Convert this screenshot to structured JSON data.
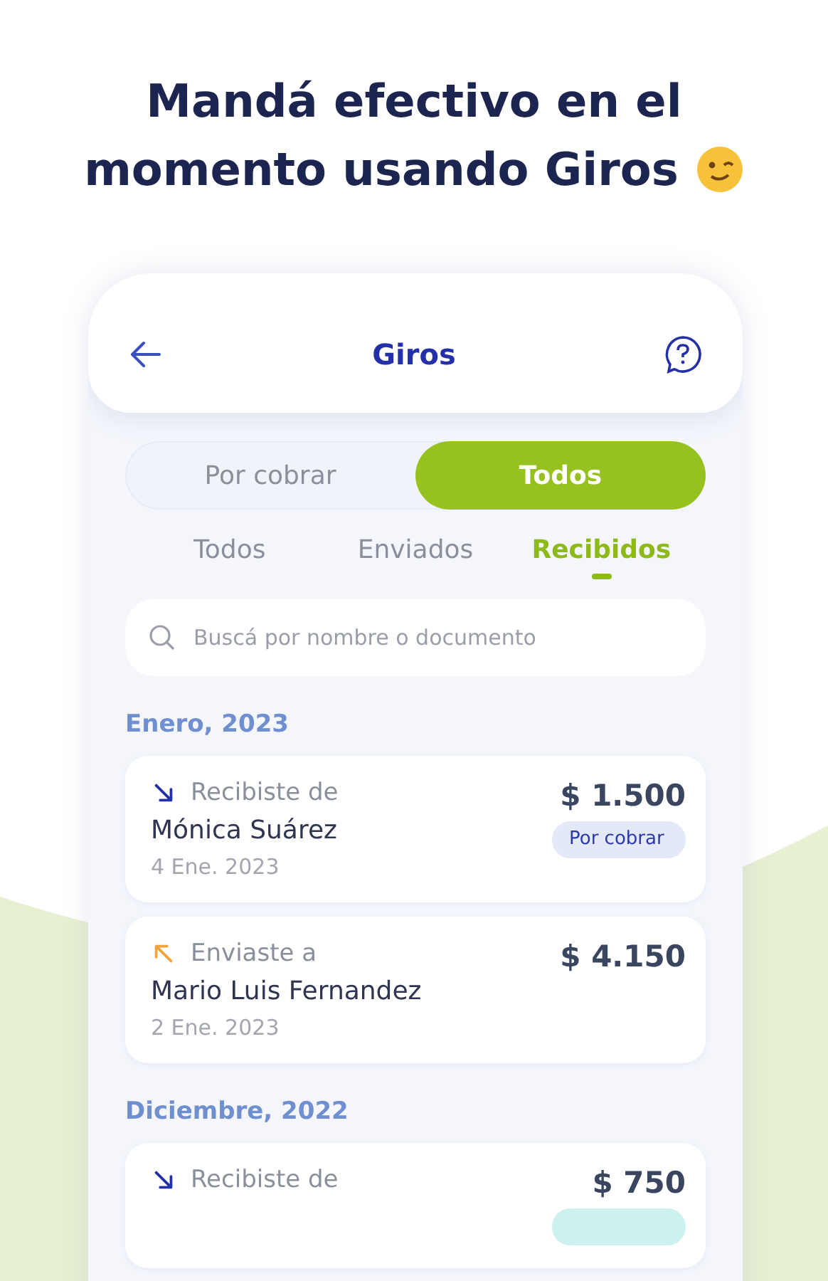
{
  "headline": {
    "lines": [
      "Mandá efectivo en el",
      "momento usando Giros"
    ]
  },
  "app_bar": {
    "title": "Giros"
  },
  "segments": [
    {
      "label": "Por cobrar",
      "selected": false
    },
    {
      "label": "Todos",
      "selected": true
    }
  ],
  "tabs": [
    {
      "label": "Todos",
      "selected": false
    },
    {
      "label": "Enviados",
      "selected": false
    },
    {
      "label": "Recibidos",
      "selected": true
    }
  ],
  "search": {
    "placeholder": "Buscá por nombre o documento"
  },
  "groups": [
    {
      "month": "Enero, 2023",
      "items": [
        {
          "kind": "received",
          "label": "Recibiste de",
          "name": "Mónica Suárez",
          "date": "4 Ene. 2023",
          "amount": "$ 1.500",
          "badge": {
            "label": "Por cobrar",
            "color": "#e4e9f8"
          }
        },
        {
          "kind": "sent",
          "label": "Enviaste a",
          "name": "Mario Luis Fernandez",
          "date": "2 Ene. 2023",
          "amount": "$ 4.150"
        }
      ]
    },
    {
      "month": "Diciembre, 2022",
      "items": [
        {
          "kind": "received",
          "label": "Recibiste de",
          "amount": "$ 750",
          "badge": {
            "color": "#cdf1ef"
          }
        }
      ]
    }
  ]
}
